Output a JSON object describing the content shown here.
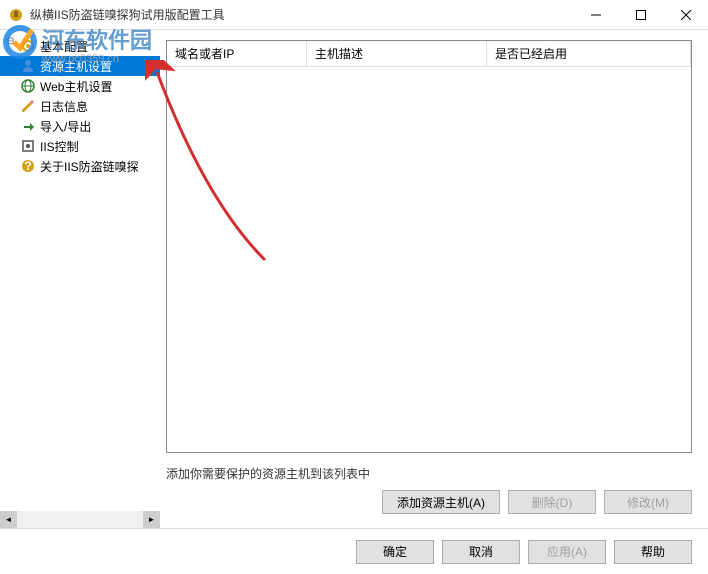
{
  "window": {
    "title": "纵横IIS防盗链嗅探狗试用版配置工具"
  },
  "sidebar": {
    "items": [
      {
        "label": "基本配置",
        "icon": "gear"
      },
      {
        "label": "资源主机设置",
        "icon": "user",
        "selected": true
      },
      {
        "label": "Web主机设置",
        "icon": "globe"
      },
      {
        "label": "日志信息",
        "icon": "pencil"
      },
      {
        "label": "导入/导出",
        "icon": "arrow"
      },
      {
        "label": "IIS控制",
        "icon": "control"
      },
      {
        "label": "关于IIS防盗链嗅探",
        "icon": "info"
      }
    ]
  },
  "table": {
    "columns": [
      "域名或者IP",
      "主机描述",
      "是否已经启用"
    ],
    "rows": []
  },
  "hint": "添加你需要保护的资源主机到该列表中",
  "actions": {
    "add": "添加资源主机(A)",
    "delete": "删除(D)",
    "edit": "修改(M)"
  },
  "footer": {
    "ok": "确定",
    "cancel": "取消",
    "apply": "应用(A)",
    "help": "帮助"
  },
  "watermark": {
    "text": "河东软件园",
    "url": "www.pc0359.cn"
  }
}
